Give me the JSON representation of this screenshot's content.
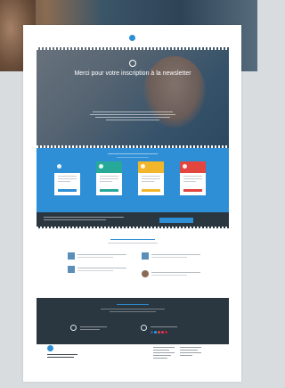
{
  "hero": {
    "title": "Merci pour votre inscription à la newsletter"
  },
  "colors": {
    "accent": "#2f8fd6",
    "dark": "#2a3640",
    "card_blue": "#2f8fd6",
    "card_teal": "#27a99a",
    "card_yellow": "#f2b62b",
    "card_red": "#e2463f"
  },
  "icons": {
    "logo": "logo-icon",
    "hero": "envelope-icon",
    "share": "share-icon"
  }
}
